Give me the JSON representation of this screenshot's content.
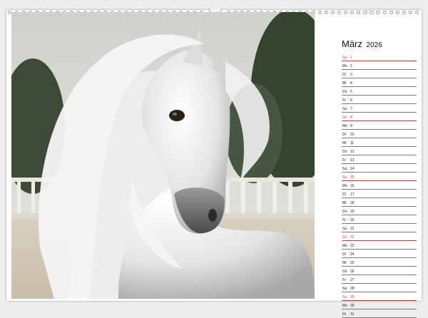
{
  "calendar": {
    "month": "März",
    "year": "2026",
    "days": [
      {
        "dow": "So",
        "day": "1",
        "sunday": true
      },
      {
        "dow": "Mo",
        "day": "2"
      },
      {
        "dow": "Di",
        "day": "3"
      },
      {
        "dow": "Mi",
        "day": "4"
      },
      {
        "dow": "Do",
        "day": "5"
      },
      {
        "dow": "Fr",
        "day": "6"
      },
      {
        "dow": "Sa",
        "day": "7"
      },
      {
        "dow": "So",
        "day": "8",
        "sunday": true
      },
      {
        "dow": "Mo",
        "day": "9"
      },
      {
        "dow": "Di",
        "day": "10"
      },
      {
        "dow": "Mi",
        "day": "11"
      },
      {
        "dow": "Do",
        "day": "12"
      },
      {
        "dow": "Fr",
        "day": "13"
      },
      {
        "dow": "Sa",
        "day": "14"
      },
      {
        "dow": "So",
        "day": "15",
        "sunday": true
      },
      {
        "dow": "Mo",
        "day": "16"
      },
      {
        "dow": "Di",
        "day": "17"
      },
      {
        "dow": "Mi",
        "day": "18"
      },
      {
        "dow": "Do",
        "day": "19"
      },
      {
        "dow": "Fr",
        "day": "20"
      },
      {
        "dow": "Sa",
        "day": "21"
      },
      {
        "dow": "So",
        "day": "22",
        "sunday": true
      },
      {
        "dow": "Mo",
        "day": "23"
      },
      {
        "dow": "Di",
        "day": "24"
      },
      {
        "dow": "Mi",
        "day": "25"
      },
      {
        "dow": "Do",
        "day": "26"
      },
      {
        "dow": "Fr",
        "day": "27"
      },
      {
        "dow": "Sa",
        "day": "28"
      },
      {
        "dow": "So",
        "day": "29",
        "sunday": true
      },
      {
        "dow": "Mo",
        "day": "30"
      },
      {
        "dow": "Di",
        "day": "31"
      }
    ]
  },
  "colors": {
    "sunday": "#c0392b",
    "line": "#7a7a7a",
    "background": "#ffffff"
  },
  "photo": {
    "subject": "white-horse-portrait"
  }
}
